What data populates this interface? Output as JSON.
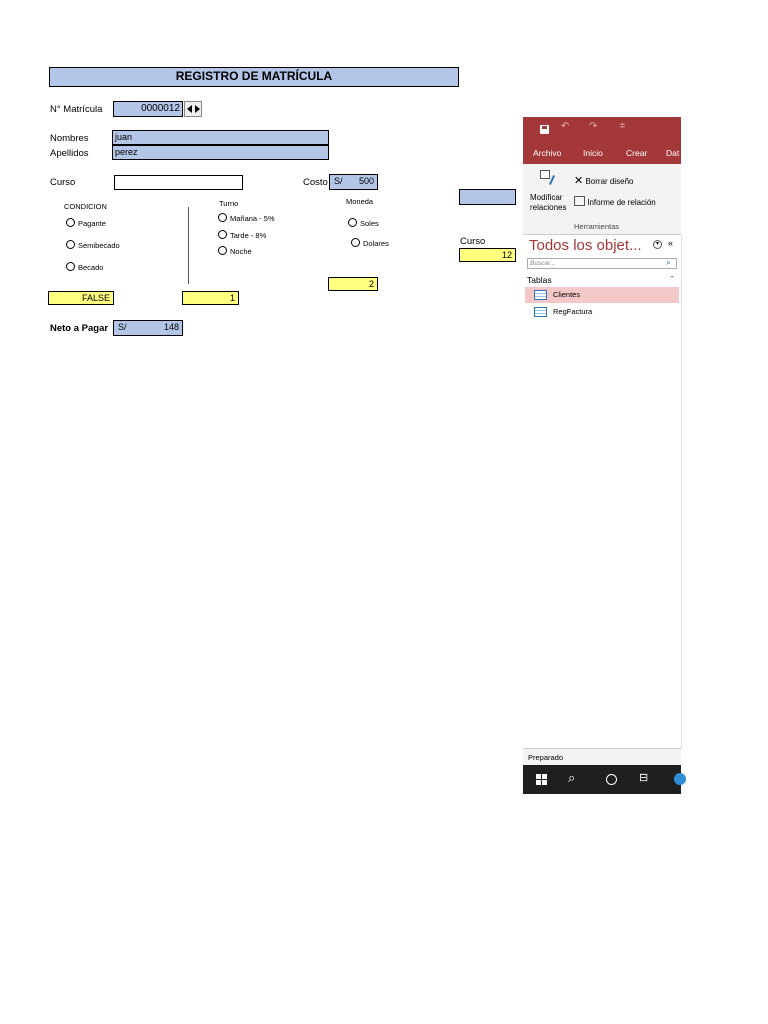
{
  "form": {
    "title": "REGISTRO DE MATRÍCULA",
    "matricula_label": "N° Matrícula",
    "matricula_value": "0000012",
    "nombres_label": "Nombres",
    "nombres_value": "juan",
    "apellidos_label": "Apellidos",
    "apellidos_value": "perez",
    "curso_label": "Curso",
    "curso_value": "",
    "costo_label": "Costo",
    "costo_currency": "S/",
    "costo_value": "500",
    "condicion": {
      "label": "CONDICION",
      "options": [
        "Pagante",
        "Semibecado",
        "Becado"
      ]
    },
    "turno": {
      "label": "Turno",
      "options": [
        "Mañana - 5%",
        "Tarde - 8%",
        "Noche"
      ]
    },
    "moneda": {
      "label": "Moneda",
      "options": [
        "Soles",
        "Dolares"
      ]
    },
    "moneda_link": "2",
    "condicion_link": "FALSE",
    "turno_link": "1",
    "curso_side_label": "Curso",
    "curso_side_value": "12",
    "neto_label": "Neto a Pagar",
    "neto_currency": "S/",
    "neto_value": "148"
  },
  "access": {
    "menu": [
      "Archivo",
      "Inicio",
      "Crear",
      "Dat"
    ],
    "ribbon": {
      "modificar": "Modificar relaciones",
      "modificar_1": "Modificar",
      "modificar_2": "relaciones",
      "borrar": "Borrar diseño",
      "informe": "Informe de relación",
      "group": "Herramientas"
    },
    "nav_title": "Todos los objet...",
    "search_placeholder": "Buscar...",
    "section": "Tablas",
    "tables": [
      "Clientes",
      "RegFactura"
    ],
    "status": "Preparado",
    "colors": {
      "titlebar": "#a4373a",
      "selected": "#f4c7c8",
      "nav_title": "#a4373a",
      "taskbar": "#1f1f1f"
    }
  }
}
